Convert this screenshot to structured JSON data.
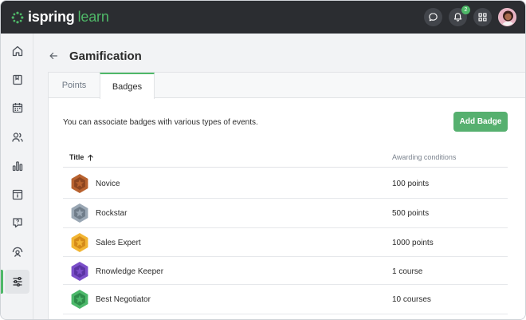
{
  "app": {
    "logo_name": "ispring",
    "logo_accent": "learn",
    "accent_color": "#4fb868",
    "topbar_color": "#2b2d31"
  },
  "topbar": {
    "chat_icon": "chat-bubble-icon",
    "notifications_icon": "bell-icon",
    "notifications_count": "2",
    "apps_icon": "grid-icon",
    "avatar_icon": "user-avatar"
  },
  "sidebar": {
    "items": [
      {
        "name": "home",
        "icon": "home-icon"
      },
      {
        "name": "courses",
        "icon": "book-icon"
      },
      {
        "name": "calendar",
        "icon": "calendar-icon"
      },
      {
        "name": "users",
        "icon": "users-icon"
      },
      {
        "name": "reports",
        "icon": "bar-chart-icon"
      },
      {
        "name": "info",
        "icon": "info-icon"
      },
      {
        "name": "help",
        "icon": "question-icon"
      },
      {
        "name": "learner-view",
        "icon": "person-target-icon"
      },
      {
        "name": "settings",
        "icon": "sliders-icon",
        "active": true
      }
    ]
  },
  "page": {
    "title": "Gamification",
    "back_icon": "arrow-left-icon"
  },
  "tabs": [
    {
      "label": "Points",
      "active": false
    },
    {
      "label": "Badges",
      "active": true
    }
  ],
  "badges": {
    "description": "You can associate badges with various types of events.",
    "add_button": "Add Badge",
    "columns": {
      "title": "Title",
      "sort_icon": "arrow-up-icon",
      "conditions": "Awarding conditions"
    },
    "rows": [
      {
        "title": "Novice",
        "condition": "100 points",
        "color": "#b8622f",
        "inner": "#8c4520",
        "icon": "bronze-star-badge-icon"
      },
      {
        "title": "Rockstar",
        "condition": "500 points",
        "color": "#9aa7b4",
        "inner": "#6f7c89",
        "icon": "silver-star-badge-icon"
      },
      {
        "title": "Sales Expert",
        "condition": "1000 points",
        "color": "#f2b533",
        "inner": "#d48a1a",
        "icon": "gold-star-badge-icon"
      },
      {
        "title": "Rnowledge Keeper",
        "condition": "1 course",
        "color": "#7b4fc9",
        "inner": "#5a34a3",
        "icon": "purple-star-badge-icon"
      },
      {
        "title": "Best Negotiator",
        "condition": "10 courses",
        "color": "#4cb86a",
        "inner": "#2e8c4a",
        "icon": "green-star-badge-icon"
      }
    ]
  }
}
